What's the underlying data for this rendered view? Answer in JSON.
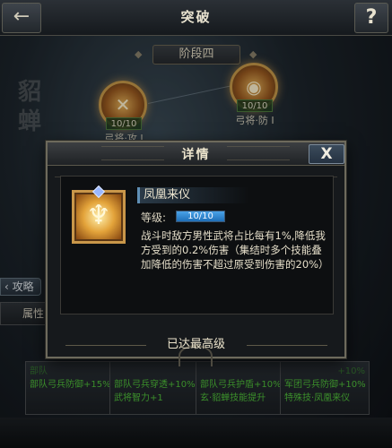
{
  "header": {
    "back_icon": "back-arrow-icon",
    "title": "突破",
    "help_label": "?"
  },
  "stage": {
    "label": "阶段四"
  },
  "background_text": {
    "char_1": "貂",
    "char_2": "蝉"
  },
  "nodes": [
    {
      "count": "10/10",
      "label": "弓将·攻 I",
      "icon": "crossed-swords-icon"
    },
    {
      "count": "10/10",
      "label": "弓将·防 I",
      "icon": "shield-icon"
    }
  ],
  "side": {
    "strategy_label": "攻略",
    "attr_label": "属性"
  },
  "cards": [
    {
      "lines": [
        "部队",
        "部队弓兵防御+15%"
      ]
    },
    {
      "lines": [
        "部队弓兵穿透+10%",
        "武将智力+1"
      ]
    },
    {
      "lines": [
        "部队弓兵护盾+10%",
        "玄·貂蝉技能提升"
      ]
    },
    {
      "lines": [
        "+10%",
        "军团弓兵防御+10%",
        "特殊技·凤凰来仪"
      ]
    }
  ],
  "modal": {
    "title": "详情",
    "close_label": "X",
    "skill": {
      "icon": "phoenix-emblem-icon",
      "name": "凤凰来仪",
      "level_label": "等级:",
      "level_value": "10/10",
      "level_progress": 1.0,
      "description": "战斗时敌方男性武将占比每有1%,降低我方受到的0.2%伤害（集结时多个技能叠加降低的伤害不超过原受到伤害的20%）"
    },
    "status": "已达最高级"
  },
  "colors": {
    "accent_gold": "#c9974a",
    "bonus_green": "#4fbf3a",
    "level_blue": "#1e6fb8"
  }
}
